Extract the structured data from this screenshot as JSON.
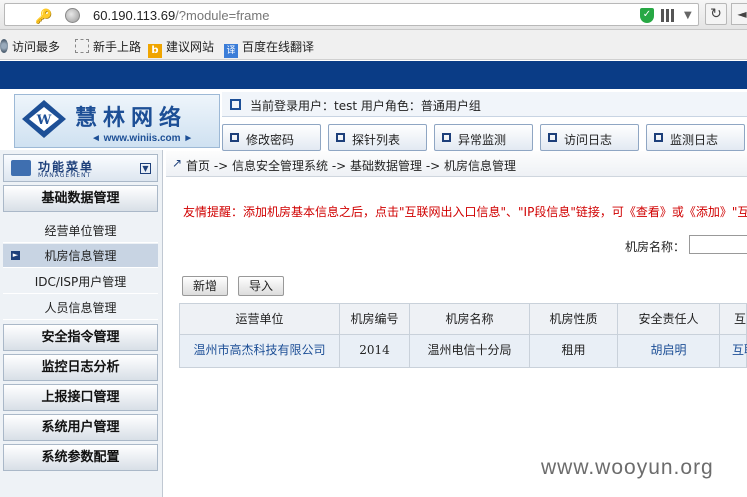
{
  "browser": {
    "url_host": "60.190.113.69",
    "url_path": "/?module=frame",
    "bookmarks": [
      "访问最多",
      "新手上路",
      "建议网站",
      "百度在线翻译"
    ]
  },
  "header": {
    "logo_name": "慧林网络",
    "logo_site": "◄ www.winiis.com ►",
    "user_info": "当前登录用户：test 用户角色：普通用户组"
  },
  "nav_tabs": [
    "修改密码",
    "探针列表",
    "异常监测",
    "访问日志",
    "监测日志"
  ],
  "sidebar": {
    "title": "功能菜单",
    "title_en": "MANAGEMENT",
    "groups": {
      "basic": "基础数据管理",
      "security": "安全指令管理",
      "log": "监控日志分析",
      "report": "上报接口管理",
      "users": "系统用户管理",
      "params": "系统参数配置"
    },
    "sub_items": [
      "经营单位管理",
      "机房信息管理",
      "IDC/ISP用户管理",
      "人员信息管理"
    ]
  },
  "breadcrumb": "首页 -> 信息安全管理系统 -> 基础数据管理 -> 机房信息管理",
  "notice": "友情提醒：添加机房基本信息之后，点击\"互联网出入口信息\"、\"IP段信息\"链接，可《查看》或《添加》\"互",
  "search": {
    "label": "机房名称：",
    "value": ""
  },
  "buttons": {
    "add": "新增",
    "import": "导入"
  },
  "table": {
    "headers": [
      "运营单位",
      "机房编号",
      "机房名称",
      "机房性质",
      "安全责任人",
      "互"
    ],
    "rows": [
      [
        "温州市高杰科技有限公司",
        "2014",
        "温州电信十分局",
        "租用",
        "胡启明",
        "互联"
      ]
    ]
  },
  "watermark": "www.wooyun.org"
}
